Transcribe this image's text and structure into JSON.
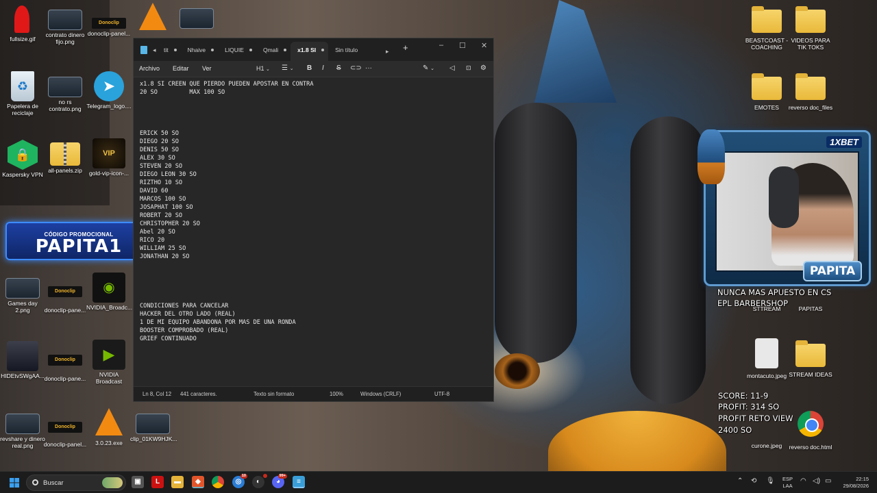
{
  "desktop": {
    "icons_left": [
      {
        "label": "fullsize.gif",
        "icon": "gif-icon"
      },
      {
        "label": "contrato dinero fijo.png",
        "icon": "image-icon"
      },
      {
        "label": "donoclip-panel...",
        "icon": "donoclip-icon"
      },
      {
        "label": "Papelera de reciclaje",
        "icon": "recycle-bin-icon"
      },
      {
        "label": "no rs contrato.png",
        "icon": "image-icon"
      },
      {
        "label": "Telegram_logo....",
        "icon": "telegram-icon"
      },
      {
        "label": "Kaspersky VPN",
        "icon": "kaspersky-icon"
      },
      {
        "label": "all-panels.zip",
        "icon": "zip-folder-icon"
      },
      {
        "label": "gold-vip-icon-...",
        "icon": "vip-icon"
      },
      {
        "label": "Games day 2.png",
        "icon": "image-icon"
      },
      {
        "label": "donoclip-pane...",
        "icon": "donoclip-icon"
      },
      {
        "label": "NVIDIA_Broadc...",
        "icon": "nvidia-icon"
      },
      {
        "label": "HIDEtvSWgAA...",
        "icon": "avatar-image-icon"
      },
      {
        "label": "donoclip-pane...",
        "icon": "donoclip-icon"
      },
      {
        "label": "NVIDIA Broadcast",
        "icon": "nvidia-broadcast-icon"
      },
      {
        "label": "revshare y dinero real.png",
        "icon": "image-icon"
      },
      {
        "label": "donoclip-panel...",
        "icon": "donoclip-icon"
      },
      {
        "label": "3.0.23.exe",
        "icon": "vlc-icon"
      },
      {
        "label": "clip_01KW9HJK...",
        "icon": "video-icon"
      }
    ],
    "icons_right": [
      {
        "label": "BEASTCOAST - COACHING",
        "icon": "folder-icon"
      },
      {
        "label": "VIDEOS PARA TIK TOKS",
        "icon": "folder-icon"
      },
      {
        "label": "EMOTES",
        "icon": "folder-icon"
      },
      {
        "label": "reverso doc_files",
        "icon": "folder-icon"
      },
      {
        "label": "STTREAM",
        "icon": "folder-icon"
      },
      {
        "label": "PAPITAS",
        "icon": "folder-icon"
      },
      {
        "label": "montacuto.jpeg",
        "icon": "image-icon"
      },
      {
        "label": "STREAM IDEAS",
        "icon": "folder-icon"
      },
      {
        "label": "curone.jpeg",
        "icon": "image-icon"
      },
      {
        "label": "reverso doc.html",
        "icon": "chrome-icon"
      }
    ]
  },
  "promo": {
    "subtitle": "CÓDIGO PROMOCIONAL",
    "code": "PAPITA1"
  },
  "notepad": {
    "tabs": [
      "tit",
      "Nhaive",
      "LIQUIE",
      "Qmali",
      "x1.8 SI",
      "Sin título"
    ],
    "active_tab_index": 4,
    "menu": {
      "file": "Archivo",
      "edit": "Editar",
      "view": "Ver"
    },
    "toolbar": {
      "heading": "H1"
    },
    "content": "x1.8 SI CREEN QUE PIERDO PUEDEN APOSTAR EN CONTRA\n20 SO         MAX 100 SO\n\n\n\n\nERICK 50 SO\nDIEGO 20 SO\nDENIS 50 SO\nALEX 30 SO\nSTEVEN 20 SO\nDIEGO LEON 30 SO\nRIZTHO 10 SO\nDAVID 60\nMARCOS 100 SO\nJOSAPHAT 100 SO\nROBERT 20 SO\nCHRISTOPHER 20 SO\nAbel 20 SO\nRICO 20\nWILLIAM 25 SO\nJONATHAN 20 SO\n\n\n\n\n\nCONDICIONES PARA CANCELAR\nHACKER DEL OTRO LADO (REAL)\n1 DE MI EQUIPO ABANDONA POR MAS DE UNA RONDA\nBOOSTER COMPROBADO (REAL)\nGRIEF CONTINUADO",
    "status": {
      "position": "Ln 8, Col 12",
      "chars": "441 caracteres.",
      "format": "Texto sin formato",
      "zoom": "100%",
      "line_endings": "Windows (CRLF)",
      "encoding": "UTF-8"
    }
  },
  "stream_overlay": {
    "brand": "1XBET",
    "name": "PAPITA",
    "line1": "NUNCA MAS APUESTO EN CS",
    "line2": "EPL BARBERSHOP",
    "score": "SCORE:  11-9",
    "profit": "PROFIT:   314 SO",
    "profit_reto": "PROFIT RETO VIEW",
    "profit_reto_value": "2400 SO"
  },
  "taskbar": {
    "search_placeholder": "Buscar",
    "lang_line1": "ESP",
    "lang_line2": "LAA",
    "time": "22:15",
    "date": "29/08/2026",
    "badges": {
      "vpn": "10",
      "discord": "99+"
    }
  }
}
